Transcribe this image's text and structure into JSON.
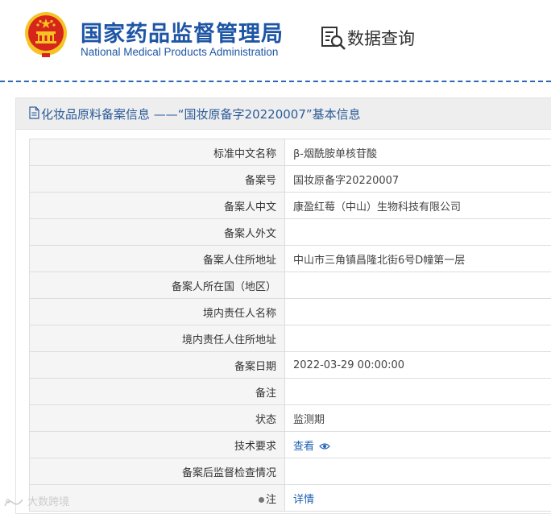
{
  "header": {
    "title_cn": "国家药品监督管理局",
    "title_en": "National Medical Products Administration",
    "query_label": "数据查询"
  },
  "panel": {
    "title": "化妆品原料备案信息 ——“国妆原备字20220007”基本信息"
  },
  "rows": [
    {
      "label": "标准中文名称",
      "value": "β-烟酰胺单核苷酸"
    },
    {
      "label": "备案号",
      "value": "国妆原备字20220007"
    },
    {
      "label": "备案人中文",
      "value": "康盈红莓（中山）生物科技有限公司"
    },
    {
      "label": "备案人外文",
      "value": ""
    },
    {
      "label": "备案人住所地址",
      "value": "中山市三角镇昌隆北街6号D幢第一层"
    },
    {
      "label": "备案人所在国（地区）",
      "value": ""
    },
    {
      "label": "境内责任人名称",
      "value": ""
    },
    {
      "label": "境内责任人住所地址",
      "value": ""
    },
    {
      "label": "备案日期",
      "value": "2022-03-29 00:00:00"
    },
    {
      "label": "备注",
      "value": ""
    },
    {
      "label": "状态",
      "value": "监测期"
    },
    {
      "label": "技术要求",
      "value": "查看"
    },
    {
      "label": "备案后监督检查情况",
      "value": ""
    },
    {
      "label": "注",
      "value": "详情"
    }
  ],
  "watermark": {
    "text": "大数跨境"
  },
  "colors": {
    "brand_blue": "#1e56a5",
    "link_blue": "#1e60b5",
    "label_bg": "#f5f5f5",
    "emblem_red": "#d6251b",
    "emblem_gold": "#f5c323"
  },
  "icons": [
    "national-emblem-icon",
    "data-query-icon",
    "document-icon",
    "eye-icon"
  ]
}
